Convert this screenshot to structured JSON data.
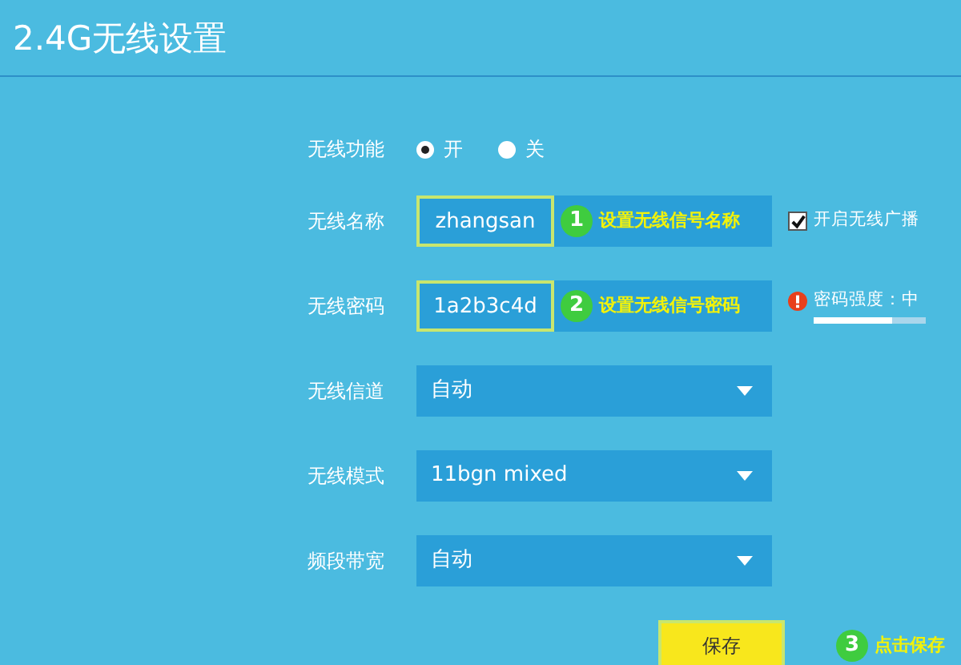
{
  "title": "2.4G无线设置",
  "wireless_function": {
    "label": "无线功能",
    "options": [
      {
        "label": "开",
        "selected": true
      },
      {
        "label": "关",
        "selected": false
      }
    ]
  },
  "ssid": {
    "label": "无线名称",
    "value": "zhangsan",
    "callout_number": "1",
    "callout_text": "设置无线信号名称",
    "broadcast": {
      "label": "开启无线广播",
      "checked": true
    }
  },
  "password": {
    "label": "无线密码",
    "value": "1a2b3c4d",
    "callout_number": "2",
    "callout_text": "设置无线信号密码",
    "strength": {
      "label": "密码强度：中",
      "level": 0.7
    }
  },
  "selects": [
    {
      "label": "无线信道",
      "value": "自动"
    },
    {
      "label": "无线模式",
      "value": "11bgn mixed"
    },
    {
      "label": "频段带宽",
      "value": "自动"
    }
  ],
  "save": {
    "button": "保存",
    "callout_number": "3",
    "callout_text": "点击保存"
  }
}
